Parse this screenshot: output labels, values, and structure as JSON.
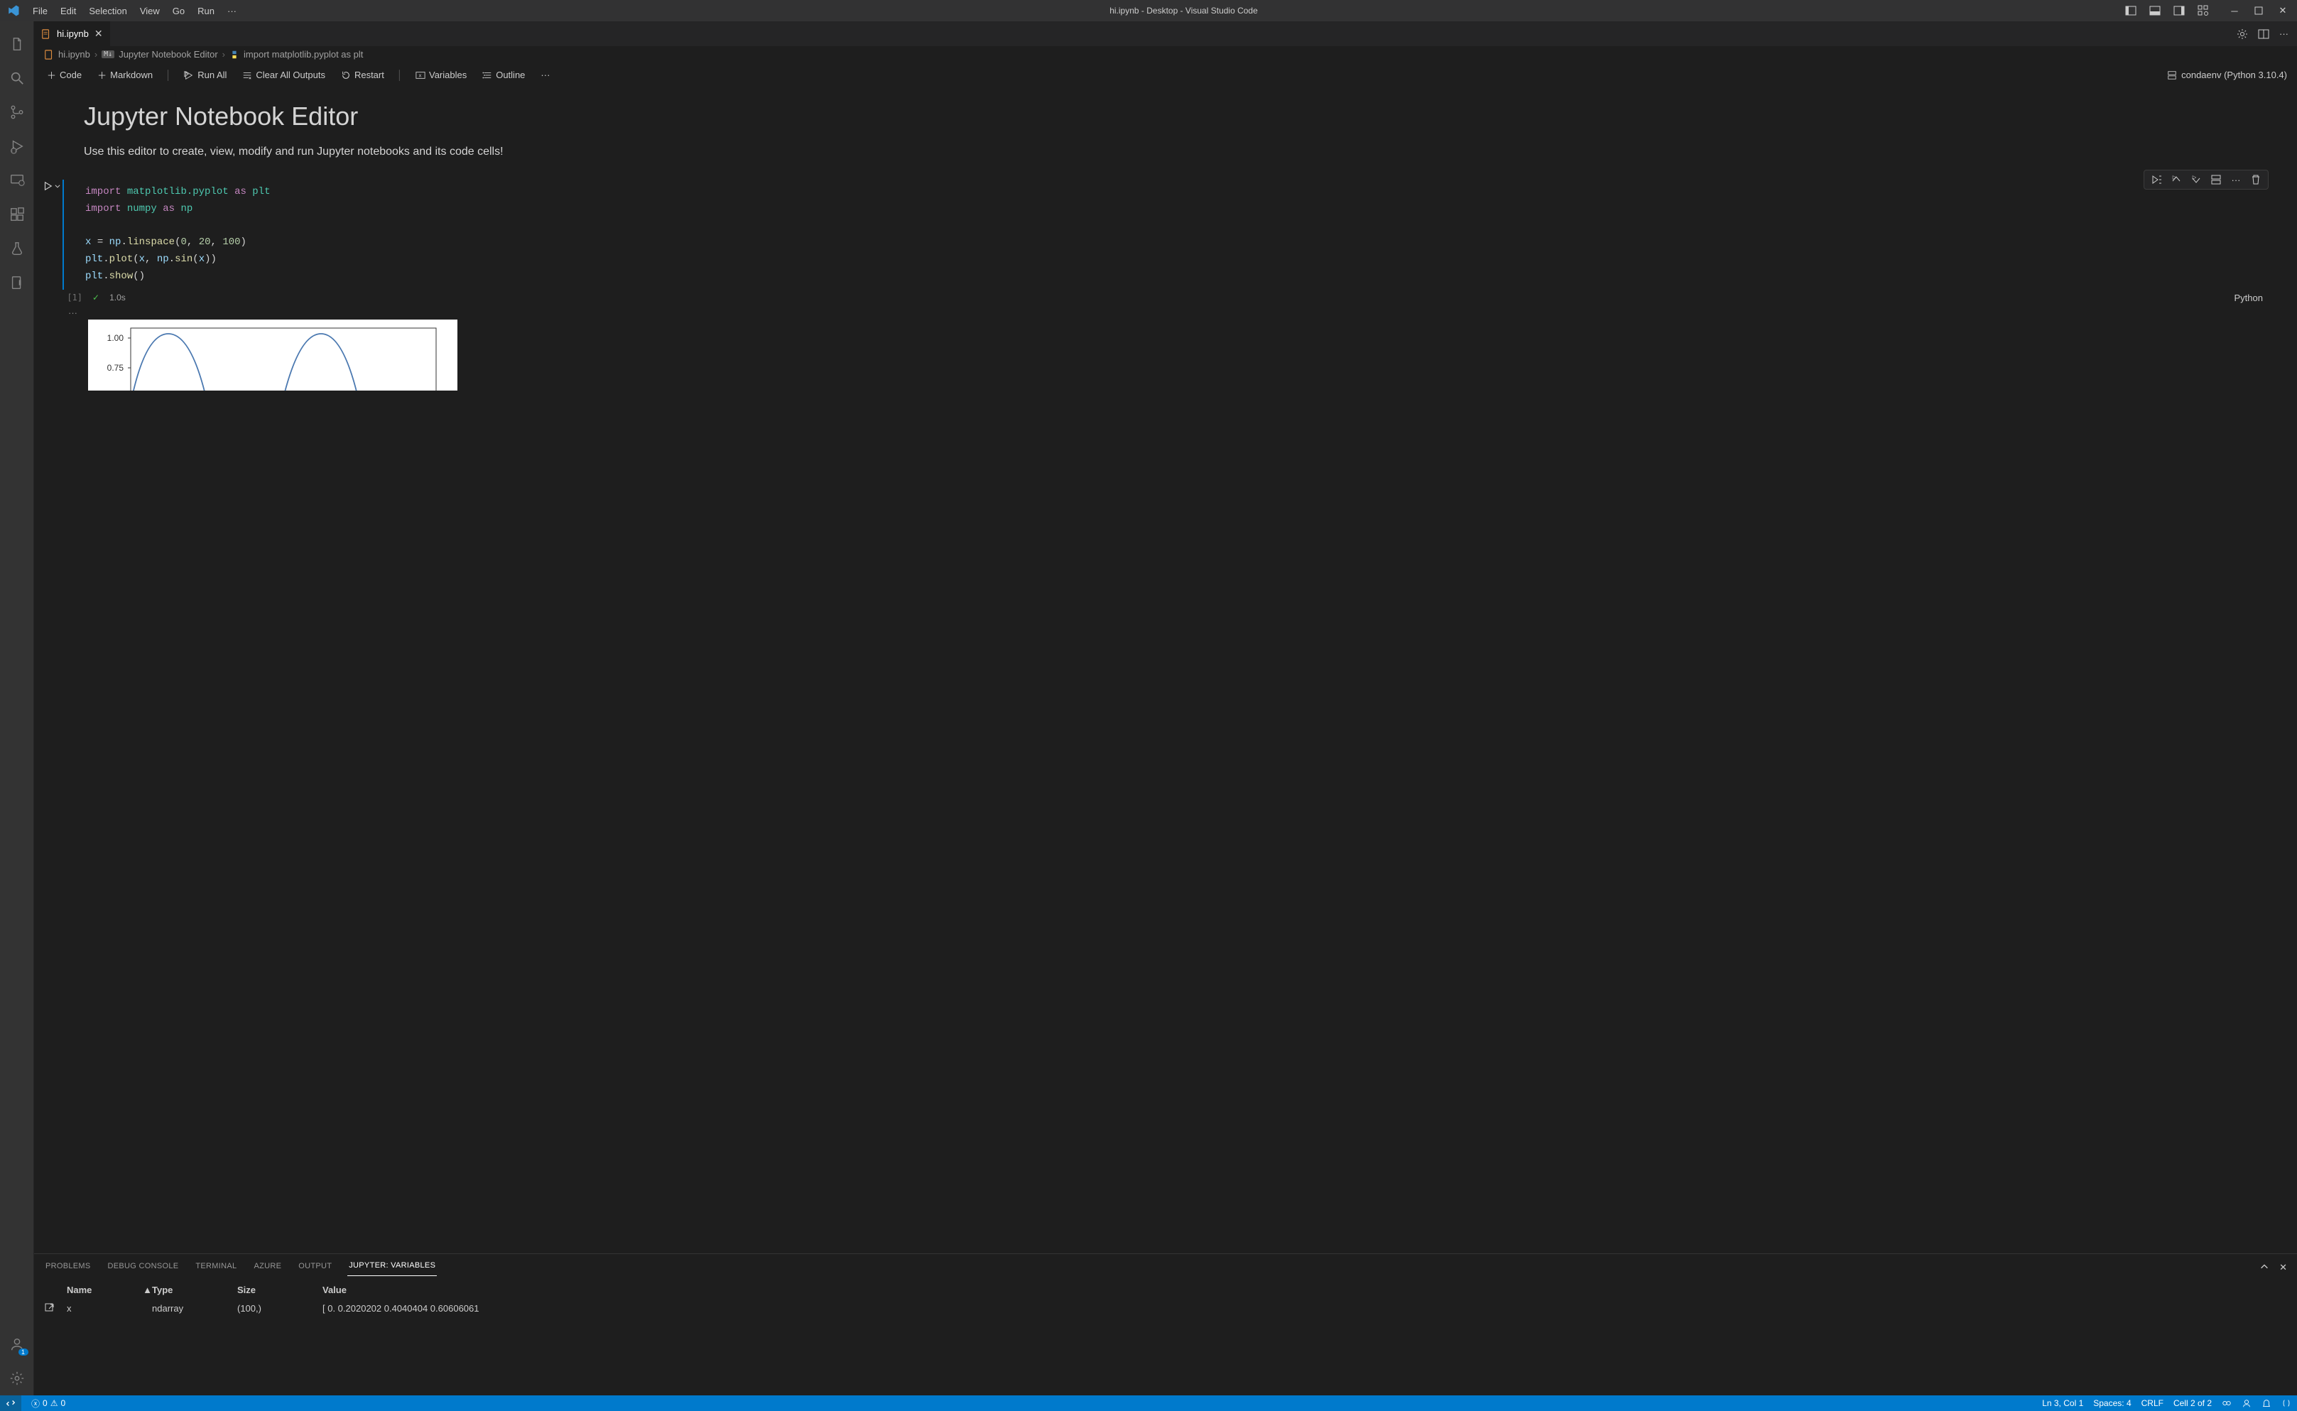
{
  "window": {
    "title": "hi.ipynb - Desktop - Visual Studio Code"
  },
  "menubar": [
    "File",
    "Edit",
    "Selection",
    "View",
    "Go",
    "Run"
  ],
  "tab": {
    "filename": "hi.ipynb"
  },
  "breadcrumb": {
    "file": "hi.ipynb",
    "editor": "Jupyter Notebook Editor",
    "symbol": "import matplotlib.pyplot as plt"
  },
  "nb_toolbar": {
    "add_code": "Code",
    "add_markdown": "Markdown",
    "run_all": "Run All",
    "clear_outputs": "Clear All Outputs",
    "restart": "Restart",
    "variables": "Variables",
    "outline": "Outline",
    "kernel": "condaenv (Python 3.10.4)"
  },
  "notebook": {
    "title": "Jupyter Notebook Editor",
    "subtitle": "Use this editor to create, view, modify and run Jupyter notebooks and its code cells!"
  },
  "cell": {
    "code": {
      "l1a": "import",
      "l1b": "matplotlib.pyplot",
      "l1c": "as",
      "l1d": "plt",
      "l2a": "import",
      "l2b": "numpy",
      "l2c": "as",
      "l2d": "np",
      "l4a": "x",
      "l4b": "=",
      "l4c": "np",
      "l4d": "linspace",
      "l4e": "0",
      "l4f": "20",
      "l4g": "100",
      "l5a": "plt",
      "l5b": "plot",
      "l5c": "x",
      "l5d": "np",
      "l5e": "sin",
      "l5f": "x",
      "l6a": "plt",
      "l6b": "show"
    },
    "exec_count": "[1]",
    "exec_time": "1.0s",
    "language": "Python"
  },
  "chart_data": {
    "type": "line",
    "title": "",
    "xlabel": "",
    "ylabel": "",
    "ylim": [
      -1,
      1
    ],
    "visible_y_ticks": [
      "1.00",
      "0.75"
    ],
    "series": [
      {
        "name": "sin(x)",
        "x_range": [
          0,
          20
        ],
        "n": 100,
        "fn": "sin"
      }
    ]
  },
  "panel": {
    "tabs": [
      "PROBLEMS",
      "DEBUG CONSOLE",
      "TERMINAL",
      "AZURE",
      "OUTPUT",
      "JUPYTER: VARIABLES"
    ],
    "active_tab": 5,
    "columns": {
      "name": "Name",
      "type": "Type",
      "size": "Size",
      "value": "Value"
    },
    "row": {
      "name": "x",
      "type": "ndarray",
      "size": "(100,)",
      "value": "[ 0.          0.2020202   0.4040404   0.60606061"
    }
  },
  "activity_bar": {
    "account_badge": "1"
  },
  "statusbar": {
    "errors": "0",
    "warnings": "0",
    "ln_col": "Ln 3, Col 1",
    "spaces": "Spaces: 4",
    "eol": "CRLF",
    "cell_pos": "Cell 2 of 2"
  }
}
